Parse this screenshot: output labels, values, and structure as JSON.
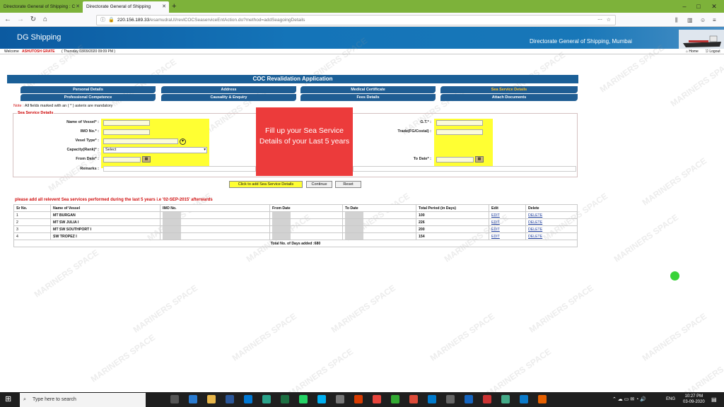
{
  "browser": {
    "tabs": [
      {
        "label": "Directorate General of Shipping : C"
      },
      {
        "label": "Directorate General of Shipping"
      }
    ],
    "url_host": "220.156.189.33",
    "url_path": "/esamudraUI/revlCOCSeaserviceEntAction.do?method=addSeagoingDetails"
  },
  "site": {
    "logo_text": "DG Shipping",
    "org_name": "Directorate General of Shipping, Mumbai",
    "welcome_label": "Welcome",
    "welcome_user": "ASHUTOSH GRATE",
    "welcome_date": "( Thursday 03/09/2020 09:09 PM )",
    "home_label": "Home",
    "logout_label": "Logout"
  },
  "page": {
    "title": "COC Revalidation Application",
    "nav_tabs": [
      {
        "label": "Personal Details"
      },
      {
        "label": "Address"
      },
      {
        "label": "Medical Certificate"
      },
      {
        "label": "Sea Service Details"
      },
      {
        "label": "Professional Competence"
      },
      {
        "label": "Causality & Enquiry"
      },
      {
        "label": "Fees Details"
      },
      {
        "label": "Attach Documents"
      }
    ],
    "note_label": "Note :",
    "note_text": "All fields marked with an ( * ) asterix are mandatory",
    "section_title": "Sea Service Details",
    "form": {
      "vessel_name_label": "Name of Vessel* :",
      "imo_label": "IMO No.* :",
      "vessel_type_label": "Vesel Type* :",
      "capacity_label": "Capacity(Rank)* :",
      "capacity_value": "Select",
      "from_date_label": "From Date* :",
      "remarks_label": "Remarks :",
      "gt_label": "G.T.* :",
      "trade_label": "Trade(FG/Costal) :",
      "to_date_label": "To Date* :"
    },
    "overlay_text": "Fill up your Sea Service Details of your Last 5 years",
    "buttons": {
      "add": "Click to add Sea Service Details",
      "continue": "Continue",
      "reset": "Reset"
    },
    "warning": "please add all relevent Sea services performed during the last 5 years i.e '02-SEP-2015' afterwards",
    "table": {
      "headers": [
        "Sr No.",
        "Name of Vessel",
        "IMO No.",
        "From Date",
        "To Date",
        "Total Period (in Days)",
        "Edit",
        "Delete"
      ],
      "rows": [
        {
          "sr": "1",
          "vessel": "MT BURGAN",
          "days": "100",
          "edit": "EDIT",
          "delete": "DELETE"
        },
        {
          "sr": "2",
          "vessel": "MT SW JULIA I",
          "days": "226",
          "edit": "EDIT",
          "delete": "DELETE"
        },
        {
          "sr": "3",
          "vessel": "MT SW SOUTHPORT I",
          "days": "200",
          "edit": "EDIT",
          "delete": "DELETE"
        },
        {
          "sr": "4",
          "vessel": "SW TROPEZ I",
          "days": "154",
          "edit": "EDIT",
          "delete": "DELETE"
        }
      ],
      "total": "Total No. of Days added :680"
    },
    "watermark_text": "MARINERS SPACE"
  },
  "taskbar": {
    "search_placeholder": "Type here to search",
    "lang": "ENG",
    "time": "10:27 PM",
    "date": "03-09-2020"
  },
  "colors": {
    "titlebar": "#7db23a",
    "header_blue": "#1474b8",
    "tab_blue": "#1f5d93",
    "active_tab_text": "#ffc125",
    "highlight": "#ffff33",
    "overlay_red": "#ec3b3b",
    "warning_red": "#d01010"
  }
}
